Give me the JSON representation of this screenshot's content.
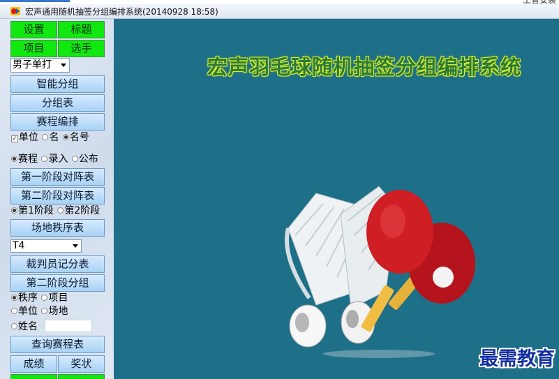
{
  "top_right_text": "土管安装",
  "window": {
    "title": "宏声通用随机抽签分组编排系统(20140928 18:58)",
    "icon": "app-icon"
  },
  "sidebar": {
    "settings_button": "设置",
    "title_button": "标题",
    "events_button": "项目",
    "players_button": "选手",
    "event_select_value": "男子单打",
    "smart_group_button": "智能分组",
    "group_table_button": "分组表",
    "schedule_button": "赛程编排",
    "display_options": {
      "unit": "单位",
      "name": "名",
      "number": "名号"
    },
    "mode_options": {
      "schedule": "赛程",
      "entry": "录入",
      "publish": "公布"
    },
    "stage1_bracket_button": "第一阶段对阵表",
    "stage2_bracket_button": "第二阶段对阵表",
    "stage_options": {
      "stage1": "第1阶段",
      "stage2": "第2阶段"
    },
    "venue_order_button": "场地秩序表",
    "venue_select_value": "T4",
    "umpire_scoresheet_button": "裁判员记分表",
    "stage2_group_button": "第二阶段分组",
    "query_options": {
      "order": "秩序",
      "event": "项目",
      "unit": "单位",
      "venue": "场地",
      "name": "姓名"
    },
    "query_schedule_button": "查询赛程表",
    "results_button": "成绩",
    "certificate_button": "奖状"
  },
  "main": {
    "banner_title": "宏声羽毛球随机抽签分组编排系统",
    "watermark": "最需教育",
    "background_color": "#1e6f88"
  }
}
